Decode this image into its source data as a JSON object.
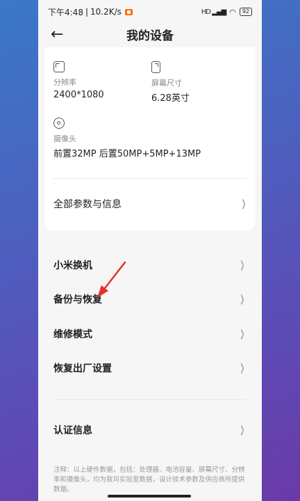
{
  "status": {
    "time": "下午4:48",
    "speed": "10.2K/s",
    "signal": "HD",
    "battery": "92"
  },
  "header": {
    "title": "我的设备"
  },
  "specs": [
    {
      "label": "分辨率",
      "value": "2400*1080"
    },
    {
      "label": "屏幕尺寸",
      "value": "6.28英寸"
    },
    {
      "label": "摄像头",
      "value": "前置32MP 后置50MP+5MP+13MP"
    }
  ],
  "card": {
    "all_params_label": "全部参数与信息"
  },
  "menu": [
    {
      "label": "小米换机"
    },
    {
      "label": "备份与恢复"
    },
    {
      "label": "维修模式"
    },
    {
      "label": "恢复出厂设置"
    }
  ],
  "certification": {
    "label": "认证信息"
  },
  "footnote": "注释：以上硬件数据，包括：处理器、电池容量、屏幕尺寸、分辨率和摄像头，均为我司实验室数据，设计技术参数及供应商所提供数据。",
  "colors": {
    "annotation_arrow": "#e8302a",
    "background_top": "#3a78c8",
    "background_bottom": "#6a3aa8"
  }
}
